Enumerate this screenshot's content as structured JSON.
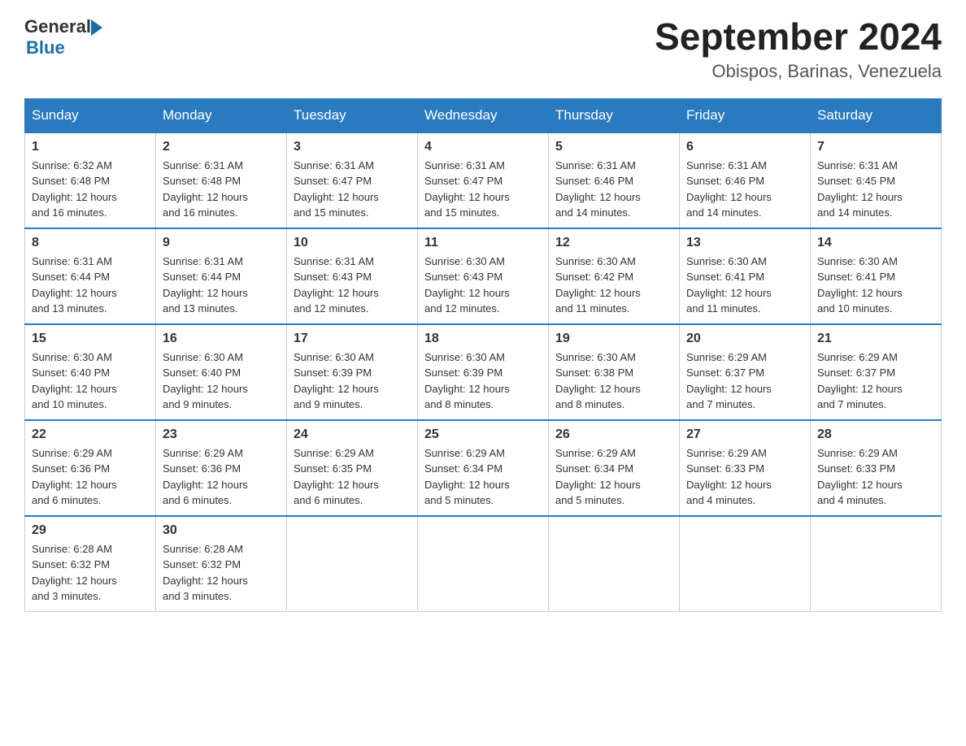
{
  "logo": {
    "text_general": "General",
    "text_blue": "Blue"
  },
  "header": {
    "month_year": "September 2024",
    "location": "Obispos, Barinas, Venezuela"
  },
  "days_of_week": [
    "Sunday",
    "Monday",
    "Tuesday",
    "Wednesday",
    "Thursday",
    "Friday",
    "Saturday"
  ],
  "weeks": [
    [
      {
        "day": "1",
        "sunrise": "6:32 AM",
        "sunset": "6:48 PM",
        "daylight": "12 hours and 16 minutes."
      },
      {
        "day": "2",
        "sunrise": "6:31 AM",
        "sunset": "6:48 PM",
        "daylight": "12 hours and 16 minutes."
      },
      {
        "day": "3",
        "sunrise": "6:31 AM",
        "sunset": "6:47 PM",
        "daylight": "12 hours and 15 minutes."
      },
      {
        "day": "4",
        "sunrise": "6:31 AM",
        "sunset": "6:47 PM",
        "daylight": "12 hours and 15 minutes."
      },
      {
        "day": "5",
        "sunrise": "6:31 AM",
        "sunset": "6:46 PM",
        "daylight": "12 hours and 14 minutes."
      },
      {
        "day": "6",
        "sunrise": "6:31 AM",
        "sunset": "6:46 PM",
        "daylight": "12 hours and 14 minutes."
      },
      {
        "day": "7",
        "sunrise": "6:31 AM",
        "sunset": "6:45 PM",
        "daylight": "12 hours and 14 minutes."
      }
    ],
    [
      {
        "day": "8",
        "sunrise": "6:31 AM",
        "sunset": "6:44 PM",
        "daylight": "12 hours and 13 minutes."
      },
      {
        "day": "9",
        "sunrise": "6:31 AM",
        "sunset": "6:44 PM",
        "daylight": "12 hours and 13 minutes."
      },
      {
        "day": "10",
        "sunrise": "6:31 AM",
        "sunset": "6:43 PM",
        "daylight": "12 hours and 12 minutes."
      },
      {
        "day": "11",
        "sunrise": "6:30 AM",
        "sunset": "6:43 PM",
        "daylight": "12 hours and 12 minutes."
      },
      {
        "day": "12",
        "sunrise": "6:30 AM",
        "sunset": "6:42 PM",
        "daylight": "12 hours and 11 minutes."
      },
      {
        "day": "13",
        "sunrise": "6:30 AM",
        "sunset": "6:41 PM",
        "daylight": "12 hours and 11 minutes."
      },
      {
        "day": "14",
        "sunrise": "6:30 AM",
        "sunset": "6:41 PM",
        "daylight": "12 hours and 10 minutes."
      }
    ],
    [
      {
        "day": "15",
        "sunrise": "6:30 AM",
        "sunset": "6:40 PM",
        "daylight": "12 hours and 10 minutes."
      },
      {
        "day": "16",
        "sunrise": "6:30 AM",
        "sunset": "6:40 PM",
        "daylight": "12 hours and 9 minutes."
      },
      {
        "day": "17",
        "sunrise": "6:30 AM",
        "sunset": "6:39 PM",
        "daylight": "12 hours and 9 minutes."
      },
      {
        "day": "18",
        "sunrise": "6:30 AM",
        "sunset": "6:39 PM",
        "daylight": "12 hours and 8 minutes."
      },
      {
        "day": "19",
        "sunrise": "6:30 AM",
        "sunset": "6:38 PM",
        "daylight": "12 hours and 8 minutes."
      },
      {
        "day": "20",
        "sunrise": "6:29 AM",
        "sunset": "6:37 PM",
        "daylight": "12 hours and 7 minutes."
      },
      {
        "day": "21",
        "sunrise": "6:29 AM",
        "sunset": "6:37 PM",
        "daylight": "12 hours and 7 minutes."
      }
    ],
    [
      {
        "day": "22",
        "sunrise": "6:29 AM",
        "sunset": "6:36 PM",
        "daylight": "12 hours and 6 minutes."
      },
      {
        "day": "23",
        "sunrise": "6:29 AM",
        "sunset": "6:36 PM",
        "daylight": "12 hours and 6 minutes."
      },
      {
        "day": "24",
        "sunrise": "6:29 AM",
        "sunset": "6:35 PM",
        "daylight": "12 hours and 6 minutes."
      },
      {
        "day": "25",
        "sunrise": "6:29 AM",
        "sunset": "6:34 PM",
        "daylight": "12 hours and 5 minutes."
      },
      {
        "day": "26",
        "sunrise": "6:29 AM",
        "sunset": "6:34 PM",
        "daylight": "12 hours and 5 minutes."
      },
      {
        "day": "27",
        "sunrise": "6:29 AM",
        "sunset": "6:33 PM",
        "daylight": "12 hours and 4 minutes."
      },
      {
        "day": "28",
        "sunrise": "6:29 AM",
        "sunset": "6:33 PM",
        "daylight": "12 hours and 4 minutes."
      }
    ],
    [
      {
        "day": "29",
        "sunrise": "6:28 AM",
        "sunset": "6:32 PM",
        "daylight": "12 hours and 3 minutes."
      },
      {
        "day": "30",
        "sunrise": "6:28 AM",
        "sunset": "6:32 PM",
        "daylight": "12 hours and 3 minutes."
      },
      null,
      null,
      null,
      null,
      null
    ]
  ]
}
